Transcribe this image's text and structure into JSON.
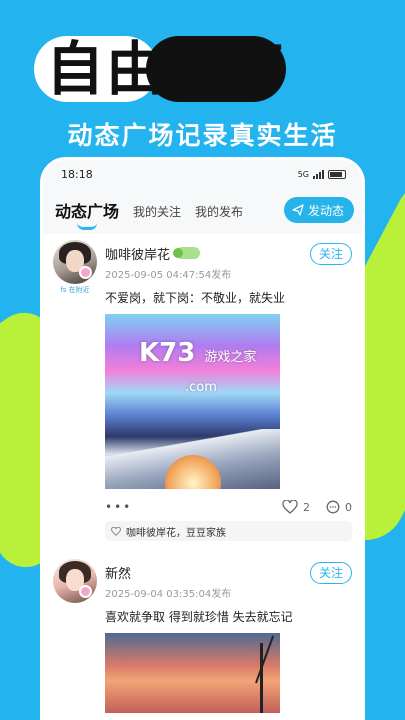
{
  "hero": {
    "title": "自由分享",
    "subtitle": "动态广场记录真实生活"
  },
  "status_bar": {
    "time": "18:18",
    "network": "5G"
  },
  "tabs": [
    {
      "label": "动态广场",
      "active": true
    },
    {
      "label": "我的关注",
      "active": false
    },
    {
      "label": "我的发布",
      "active": false
    }
  ],
  "post_button": {
    "label": "发动态"
  },
  "posts": [
    {
      "author": "咖啡彼岸花",
      "avatar_tag": "fs 在附近",
      "time": "2025-09-05 04:47:54发布",
      "text": "不爱岗，就下岗：不敬业，就失业",
      "follow_label": "关注",
      "likes": "2",
      "comments": "0",
      "liked_by": "咖啡彼岸花，豆豆家族"
    },
    {
      "author": "新然",
      "time": "2025-09-04 03:35:04发布",
      "text": "喜欢就争取 得到就珍惜 失去就忘记",
      "follow_label": "关注"
    }
  ],
  "watermark": {
    "brand": "K73",
    "text": "游戏之家",
    "domain": ".com"
  },
  "colors": {
    "accent": "#2ab6ee",
    "background": "#23b4ef",
    "lime": "#b9f03a"
  }
}
